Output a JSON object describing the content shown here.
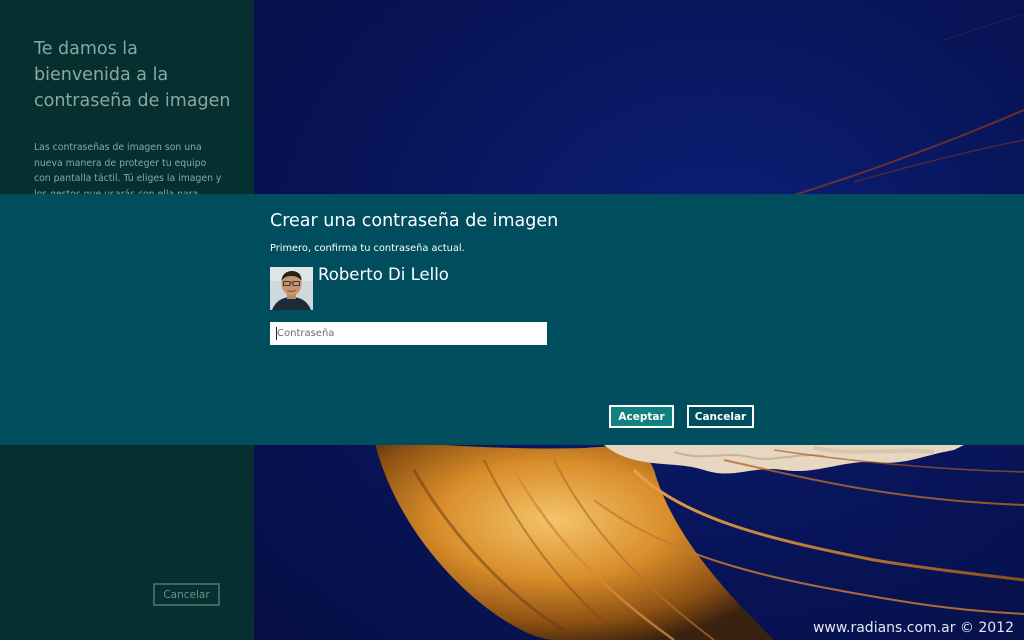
{
  "welcome_panel": {
    "title": "Te damos la bienvenida a la contraseña de imagen",
    "description": "Las contraseñas de imagen son una nueva manera de proteger tu equipo con pantalla táctil. Tú eliges la imagen y los gestos que usarás con ella para crear",
    "cancel_label": "Cancelar"
  },
  "dialog": {
    "title": "Crear una contraseña de imagen",
    "subtitle": "Primero, confirma tu contraseña actual.",
    "user_name": "Roberto Di Lello",
    "password_placeholder": "Contraseña",
    "password_value": "",
    "ok_label": "Aceptar",
    "cancel_label": "Cancelar"
  },
  "watermark": "www.radians.com.ar © 2012",
  "colors": {
    "side_panel": "#05302f",
    "dialog_band": "#004d5e",
    "accent_button": "#11807f",
    "background": "#0a1150"
  },
  "icons": {
    "avatar": "user-avatar-photo"
  }
}
